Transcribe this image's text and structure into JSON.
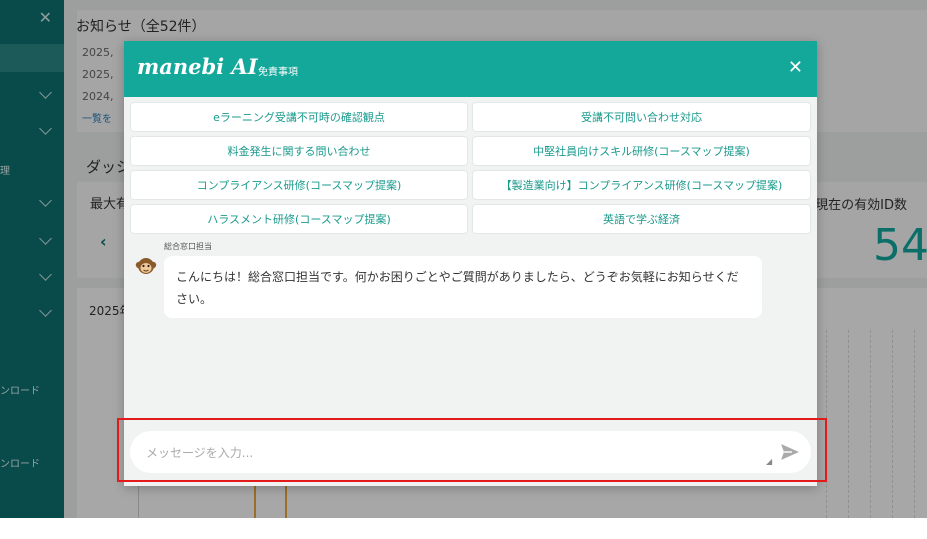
{
  "sidebar": {
    "close_icon": "close-icon",
    "items": [
      {
        "label": "理"
      },
      {
        "label": "ンロード"
      },
      {
        "label": "ンロード"
      }
    ]
  },
  "background": {
    "notice_title": "お知らせ（全52件）",
    "notice_lines": [
      "2025,",
      "2025,",
      "2024,"
    ],
    "notice_link": "一覧を",
    "dashboard_title": "ダッシ",
    "dashboard_max": "最大有",
    "id_label": "現在の有効ID数",
    "id_value": "54",
    "chart_year": "2025年"
  },
  "chat": {
    "brand": "manebi AI",
    "disclaimer": "免責事項",
    "suggestions": [
      "eラーニング受講不可時の確認観点",
      "受講不可問い合わせ対応",
      "料金発生に関する問い合わせ",
      "中堅社員向けスキル研修(コースマップ提案)",
      "コンプライアンス研修(コースマップ提案)",
      "【製造業向け】コンプライアンス研修(コースマップ提案)",
      "ハラスメント研修(コースマップ提案)",
      "英語で学ぶ経済"
    ],
    "sender": "総合窓口担当",
    "message": "こんにちは！総合窓口担当です。何かお困りごとやご質問がありましたら、どうぞお気軽にお知らせください。",
    "input_placeholder": "メッセージを入力...",
    "input_value": ""
  },
  "colors": {
    "header": "#14a89b",
    "accent_text": "#1a9a8c",
    "highlight": "#e21a1a",
    "sidebar": "#0e6d6d"
  }
}
